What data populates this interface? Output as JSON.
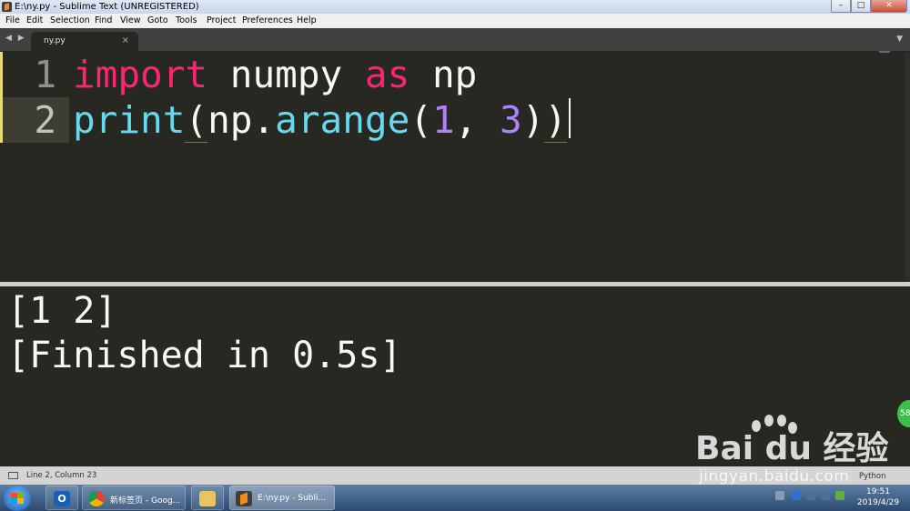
{
  "window": {
    "title": "E:\\ny.py - Sublime Text (UNREGISTERED)"
  },
  "menu": [
    "File",
    "Edit",
    "Selection",
    "Find",
    "View",
    "Goto",
    "Tools",
    "Project",
    "Preferences",
    "Help"
  ],
  "tabs": [
    {
      "label": "ny.py",
      "close": "×"
    }
  ],
  "tab_nav": "◀ ▶",
  "tab_dropdown": "▼",
  "window_buttons": {
    "minimize": "–",
    "maximize": "□",
    "close": "✕"
  },
  "editor": {
    "line_numbers": [
      "1",
      "2"
    ],
    "line1": {
      "kw_import": "import",
      "mod": " numpy ",
      "kw_as": "as",
      "alias": " np"
    },
    "line2": {
      "fn_print": "print",
      "open1": "(",
      "obj": "np.",
      "fn_arange": "arange",
      "open2": "(",
      "n1": "1",
      "comma": ", ",
      "n2": "3",
      "close2": ")",
      "close1": ")"
    }
  },
  "output": {
    "lines": [
      "[1 2]",
      "[Finished in 0.5s]"
    ]
  },
  "status": {
    "position": "Line 2, Column 23",
    "syntax": "Python"
  },
  "taskbar": {
    "chrome_label": "新标签页 - Goog...",
    "sublime_label": "E:\\ny.py - Subli...",
    "outlook_glyph": "O"
  },
  "clock": {
    "time": "19:51",
    "date": "2019/4/29"
  },
  "badge": "58",
  "watermark": {
    "brand": "Bai du 经验",
    "url": "jingyan.baidu.com"
  },
  "colors": {
    "keyword": "#f92672",
    "function": "#66d9ef",
    "number": "#ae81ff",
    "background": "#272822"
  }
}
